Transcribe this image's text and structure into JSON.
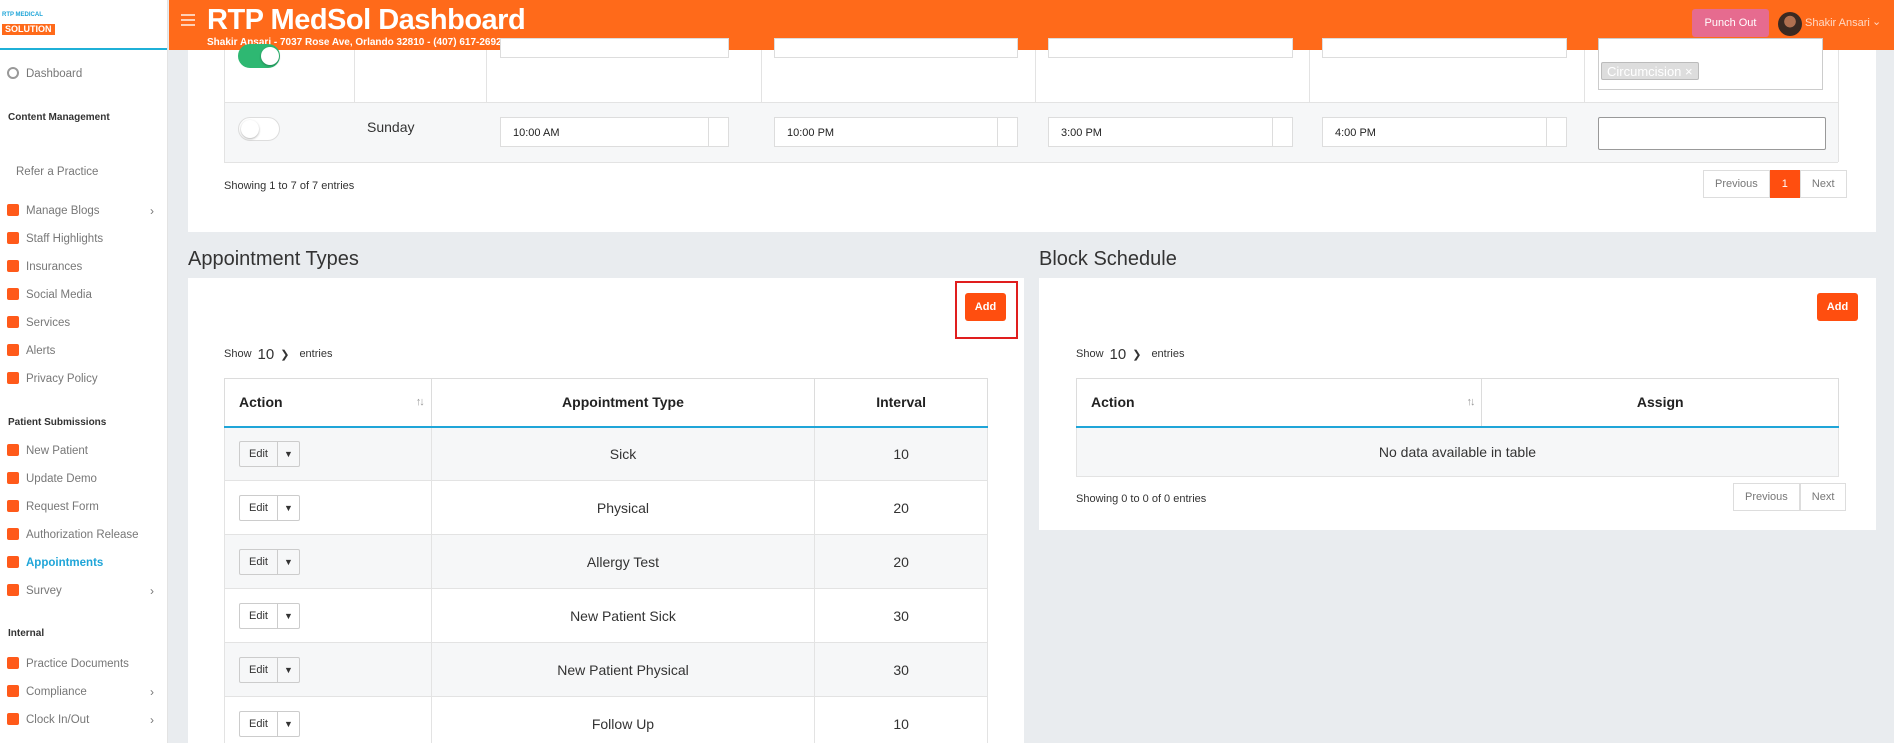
{
  "app": {
    "logo_line1": "RTP MEDICAL",
    "logo_line2": "SOLUTION",
    "title": "RTP MedSol Dashboard",
    "subtitle": "Shakir Ansari - 7037 Rose Ave, Orlando 32810 - (407) 617-2692",
    "punch_out": "Punch Out",
    "user_name": "Shakir Ansari",
    "accent": "#ff6a1a",
    "primary_btn": "#ff4e0f",
    "link_active": "#1fa5d8"
  },
  "sidebar": {
    "dashboard": "Dashboard",
    "content_management": "Content Management",
    "refer": "Refer a Practice",
    "items_content": [
      {
        "label": "Manage Blogs",
        "icon": "blog-icon",
        "has_sub": true
      },
      {
        "label": "Staff Highlights",
        "icon": "staff-icon",
        "has_sub": false
      },
      {
        "label": "Insurances",
        "icon": "building-icon",
        "has_sub": false
      },
      {
        "label": "Social Media",
        "icon": "social-icon",
        "has_sub": false
      },
      {
        "label": "Services",
        "icon": "bell-icon",
        "has_sub": false
      },
      {
        "label": "Alerts",
        "icon": "phone-icon",
        "has_sub": false
      },
      {
        "label": "Privacy Policy",
        "icon": "shield-icon",
        "has_sub": false
      }
    ],
    "patient_submissions": "Patient Submissions",
    "items_patient": [
      {
        "label": "New Patient",
        "icon": "home-icon",
        "has_sub": false
      },
      {
        "label": "Update Demo",
        "icon": "car-icon",
        "has_sub": false
      },
      {
        "label": "Request Form",
        "icon": "form-icon",
        "has_sub": false
      },
      {
        "label": "Authorization Release",
        "icon": "check-doc-icon",
        "has_sub": false
      },
      {
        "label": "Appointments",
        "icon": "calendar-icon",
        "has_sub": false
      },
      {
        "label": "Survey",
        "icon": "chart-icon",
        "has_sub": true
      }
    ],
    "internal": "Internal",
    "items_internal": [
      {
        "label": "Practice Documents",
        "icon": "clipboard-icon",
        "has_sub": false
      },
      {
        "label": "Compliance",
        "icon": "signature-icon",
        "has_sub": true
      },
      {
        "label": "Clock In/Out",
        "icon": "clock-icon",
        "has_sub": true
      }
    ]
  },
  "hours": {
    "tags": [
      "Circumcision"
    ],
    "sunday": {
      "day": "Sunday",
      "open": "10:00 AM",
      "close": "10:00 PM",
      "lunch_start": "3:00 PM",
      "lunch_end": "4:00 PM"
    },
    "info": "Showing 1 to 7 of 7 entries",
    "prev": "Previous",
    "page": "1",
    "next": "Next"
  },
  "appointment_types": {
    "title": "Appointment Types",
    "add": "Add",
    "show": "Show",
    "show_value": "10",
    "entries": "entries",
    "columns": [
      "Action",
      "Appointment Type",
      "Interval"
    ],
    "edit": "Edit",
    "rows": [
      {
        "type": "Sick",
        "interval": "10"
      },
      {
        "type": "Physical",
        "interval": "20"
      },
      {
        "type": "Allergy Test",
        "interval": "20"
      },
      {
        "type": "New Patient Sick",
        "interval": "30"
      },
      {
        "type": "New Patient Physical",
        "interval": "30"
      },
      {
        "type": "Follow Up",
        "interval": "10"
      }
    ]
  },
  "block_schedule": {
    "title": "Block Schedule",
    "add": "Add",
    "show": "Show",
    "show_value": "10",
    "entries": "entries",
    "columns": [
      "Action",
      "Assign"
    ],
    "empty": "No data available in table",
    "info": "Showing 0 to 0 of 0 entries",
    "prev": "Previous",
    "next": "Next"
  }
}
